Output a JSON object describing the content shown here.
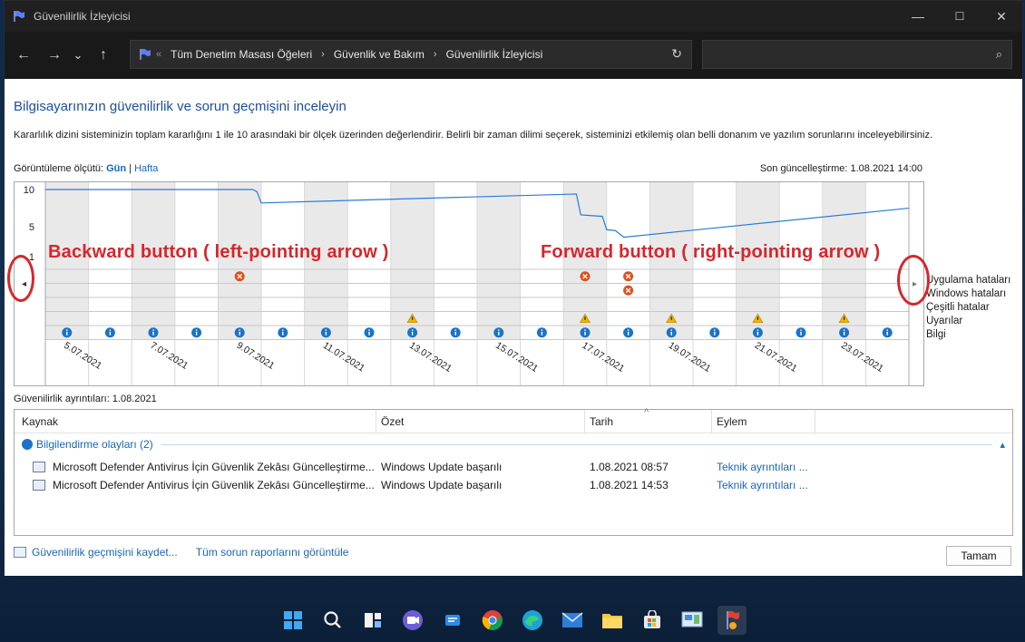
{
  "window": {
    "title": "Güvenilirlik İzleyicisi",
    "controls": {
      "minimize": "—",
      "maximize": "☐",
      "close": "✕"
    }
  },
  "nav": {
    "back": "←",
    "forward": "→",
    "recent": "⌄",
    "up": "↑",
    "address_prefix": "«",
    "breadcrumbs": [
      "Tüm Denetim Masası Öğeleri",
      "Güvenlik ve Bakım",
      "Güvenilirlik İzleyicisi"
    ],
    "breadcrumb_sep": "›",
    "refresh": "↻",
    "search_placeholder": "",
    "search_icon": "⌕"
  },
  "page": {
    "heading": "Bilgisayarınızın güvenilirlik ve sorun geçmişini inceleyin",
    "description": "Kararlılık dizini sisteminizin toplam kararlığını 1 ile 10 arasındaki bir ölçek üzerinden değerlendirir. Belirli bir zaman dilimi seçerek, sisteminizi etkilemiş olan belli donanım ve yazılım sorunlarını inceleyebilirsiniz.",
    "view_label": "Görüntüleme ölçütü:",
    "view_day": "Gün",
    "view_sep": "|",
    "view_week": "Hafta",
    "last_updated": "Son güncelleştirme: 1.08.2021 14:00"
  },
  "chart_data": {
    "type": "line",
    "y_ticks": [
      "10",
      "5",
      "1"
    ],
    "ylim": [
      1,
      10
    ],
    "columns": 20,
    "x_labels": [
      "5.07.2021",
      "7.07.2021",
      "9.07.2021",
      "11.07.2021",
      "13.07.2021",
      "15.07.2021",
      "17.07.2021",
      "19.07.2021",
      "21.07.2021",
      "23.07.2021"
    ],
    "stability_index": [
      {
        "x": 0,
        "y": 10.0
      },
      {
        "x": 4.8,
        "y": 10.0
      },
      {
        "x": 4.9,
        "y": 9.7
      },
      {
        "x": 5.0,
        "y": 8.2
      },
      {
        "x": 12.3,
        "y": 9.4
      },
      {
        "x": 12.4,
        "y": 6.6
      },
      {
        "x": 12.9,
        "y": 6.4
      },
      {
        "x": 13.0,
        "y": 4.6
      },
      {
        "x": 13.2,
        "y": 4.5
      },
      {
        "x": 13.4,
        "y": 3.6
      },
      {
        "x": 20.0,
        "y": 7.5
      }
    ],
    "rows": [
      "Uygulama hataları",
      "Windows hataları",
      "Çeşitli hatalar",
      "Uyarılar",
      "Bilgi"
    ],
    "error_events": [
      {
        "col": 4,
        "row": 0
      },
      {
        "col": 12,
        "row": 0
      },
      {
        "col": 13,
        "row": 0
      },
      {
        "col": 13,
        "row": 1
      }
    ],
    "warning_events": [
      8,
      12,
      14,
      16,
      18
    ],
    "info_events": [
      0,
      1,
      2,
      3,
      4,
      5,
      6,
      7,
      8,
      9,
      10,
      11,
      12,
      13,
      14,
      15,
      16,
      17,
      18,
      19
    ],
    "shaded_columns": [
      0,
      2,
      4,
      6,
      8,
      10,
      12,
      14,
      16,
      18
    ]
  },
  "annotations": {
    "backward": "Backward button ( left-pointing arrow )",
    "forward": "Forward button ( right-pointing arrow )"
  },
  "chart_nav": {
    "left": "◂",
    "right": "▸"
  },
  "details": {
    "label": "Güvenilirlik ayrıntıları: 1.08.2021",
    "columns": [
      "Kaynak",
      "Özet",
      "Tarih",
      "Eylem"
    ],
    "sort_indicator": "^",
    "group": {
      "label": "Bilgilendirme olayları (2)",
      "toggle": "▴"
    },
    "rows": [
      {
        "source": "Microsoft Defender Antivirus İçin Güvenlik Zekâsı Güncelleştirme...",
        "summary": "Windows Update başarılı",
        "date": "1.08.2021 08:57",
        "action": "Teknik ayrıntıları ..."
      },
      {
        "source": "Microsoft Defender Antivirus İçin Güvenlik Zekâsı Güncelleştirme...",
        "summary": "Windows Update başarılı",
        "date": "1.08.2021 14:53",
        "action": "Teknik ayrıntıları ..."
      }
    ]
  },
  "footer": {
    "save_history": "Güvenilirlik geçmişini kaydet...",
    "view_all": "Tüm sorun raporlarını görüntüle",
    "ok": "Tamam"
  },
  "colors": {
    "accent": "#1a66b8",
    "line": "#2a7bd4",
    "error": "#d9531e",
    "warning": "#f0b400",
    "info": "#1a73c8",
    "annotation": "#d6262c"
  }
}
